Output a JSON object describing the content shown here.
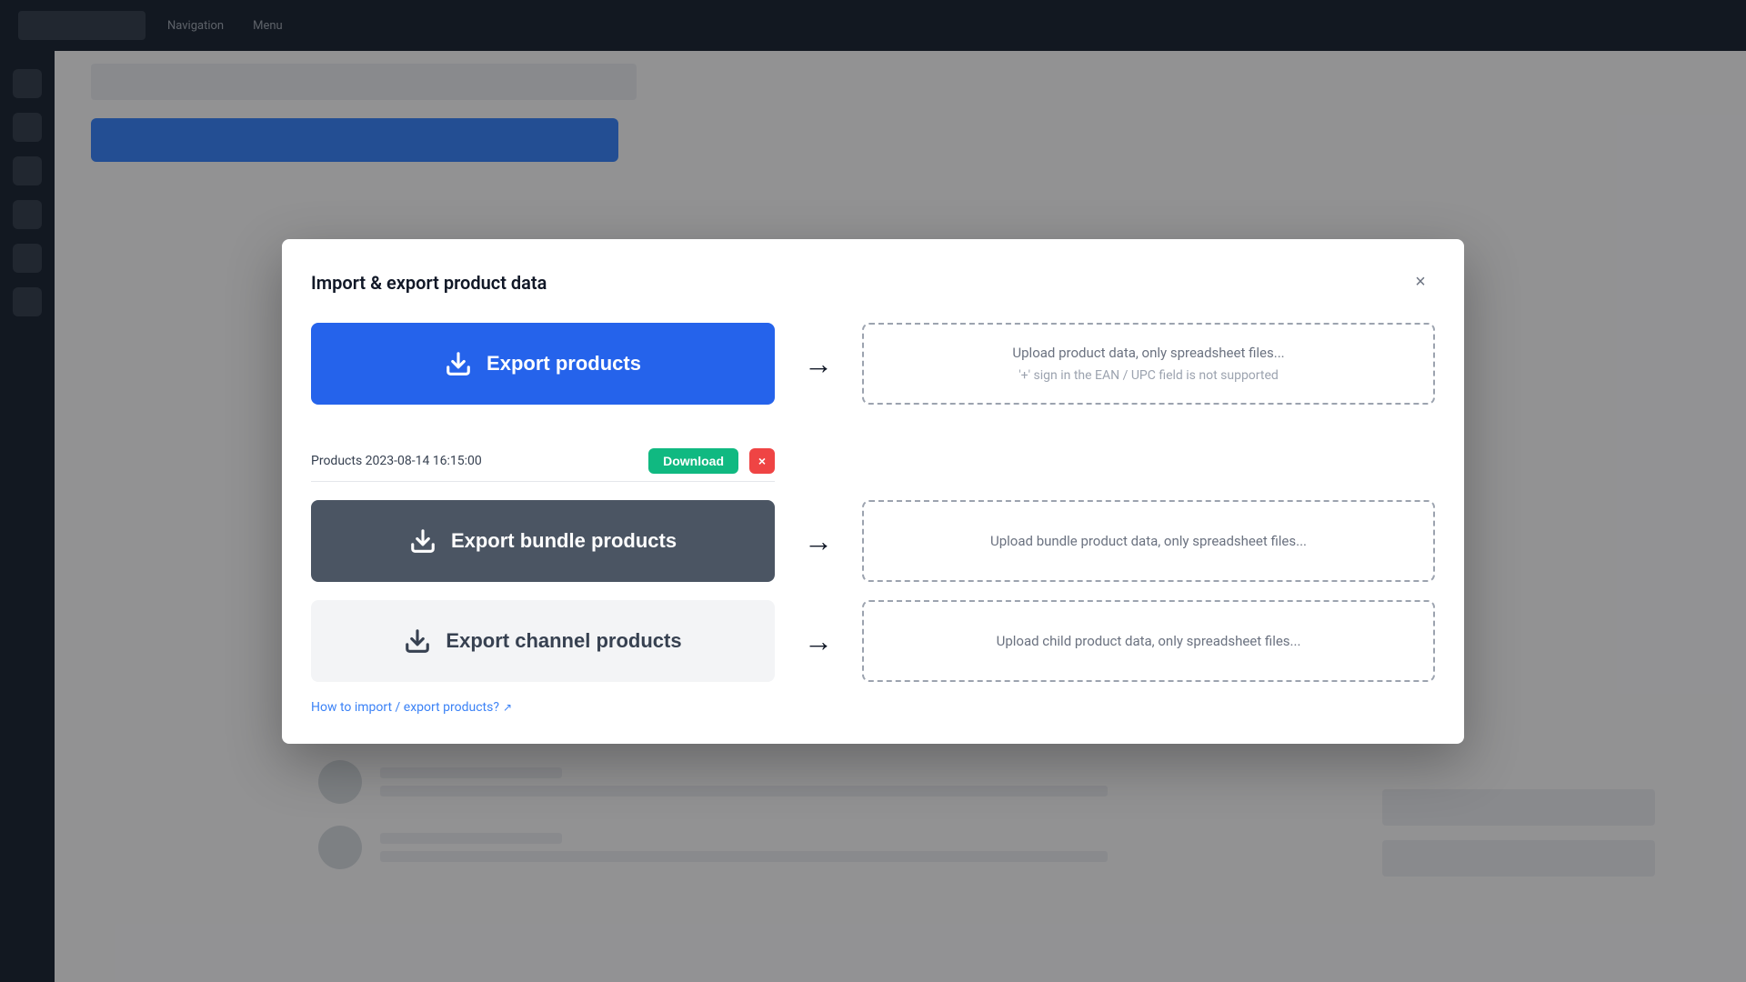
{
  "modal": {
    "title": "Import & export product data",
    "close_label": "×"
  },
  "export_products": {
    "btn_label": "Export products",
    "dl_filename": "Products 2023-08-14 16:15:00",
    "dl_btn_label": "Download",
    "del_btn_label": "×"
  },
  "export_bundle": {
    "btn_label": "Export bundle products"
  },
  "export_channel": {
    "btn_label": "Export channel products"
  },
  "upload_area_1": {
    "line1": "Upload product data, only spreadsheet files...",
    "line2": "'+' sign in the EAN / UPC field is not supported"
  },
  "upload_area_2": {
    "line1": "Upload bundle product data, only spreadsheet files..."
  },
  "upload_area_3": {
    "line1": "Upload child product data, only spreadsheet files..."
  },
  "help": {
    "link_text": "How to import / export products?",
    "icon": "↗"
  },
  "arrows": {
    "symbol": "→"
  }
}
